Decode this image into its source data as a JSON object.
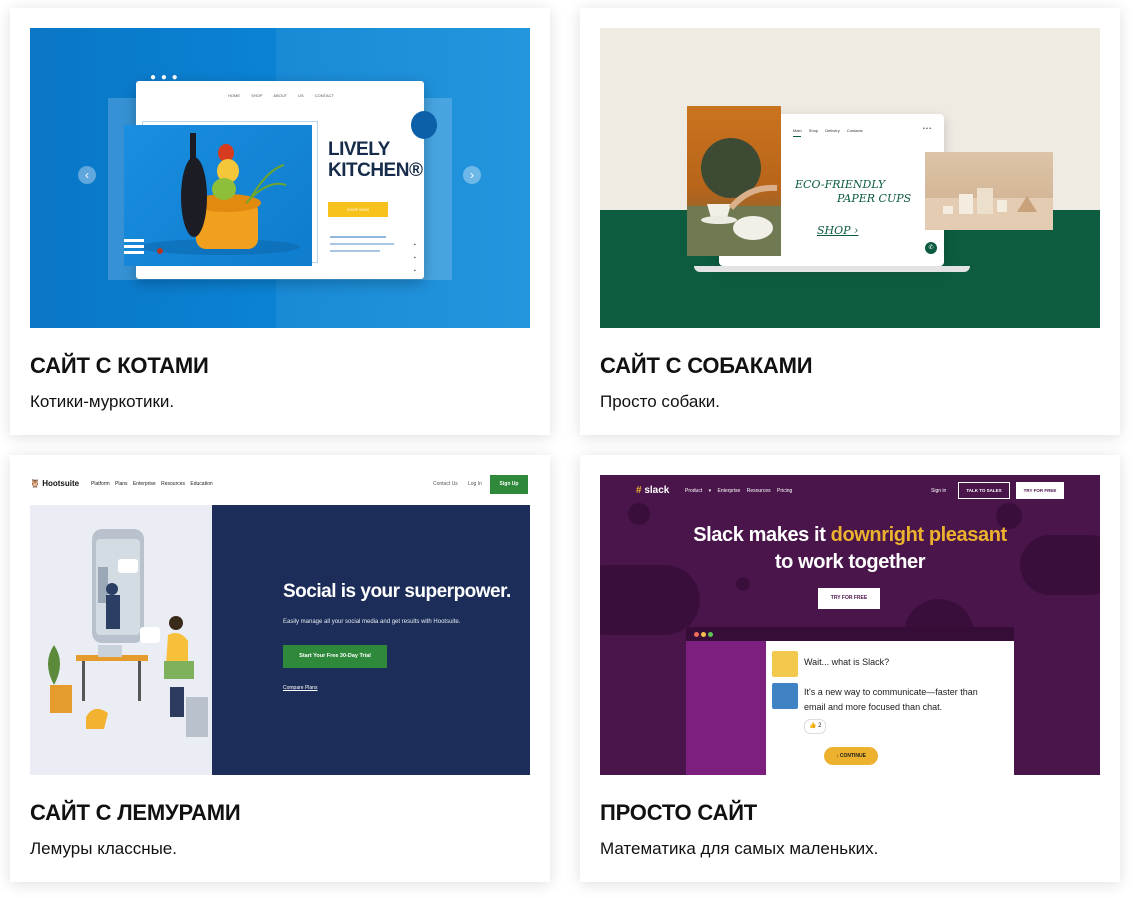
{
  "cards": [
    {
      "title": "САЙТ С КОТАМИ",
      "description": "Котики-муркотики.",
      "preview": {
        "nav": [
          "HOME",
          "SHOP",
          "ABOUT US",
          "CONTACT"
        ],
        "heading_line1": "LIVELY",
        "heading_line2": "KITCHEN®",
        "button": "SHOP NOW"
      }
    },
    {
      "title": "САЙТ С СОБАКАМИ",
      "description": "Просто собаки.",
      "preview": {
        "nav": [
          "Main",
          "Shop",
          "Delivery",
          "Contacts"
        ],
        "heading_line1": "ECO-FRIENDLY",
        "heading_line2": "PAPER CUPS",
        "shop_link": "SHOP ›"
      }
    },
    {
      "title": "САЙТ С ЛЕМУРАМИ",
      "description": "Лемуры классные.",
      "preview": {
        "logo": "Hootsuite",
        "nav": [
          "Platform",
          "Plans",
          "Enterprise",
          "Resources",
          "Education"
        ],
        "contact": "Contact Us",
        "login": "Log In",
        "signup": "Sign Up",
        "headline": "Social is your superpower.",
        "subtext": "Easily manage all your social media and get results with Hootsuite.",
        "cta": "Start Your Free 30-Day Trial",
        "compare": "Compare Plans"
      }
    },
    {
      "title": "ПРОСТО САЙТ",
      "description": "Математика для самых маленьких.",
      "preview": {
        "logo": "slack",
        "nav": [
          "Product ▾",
          "Enterprise",
          "Resources",
          "Pricing"
        ],
        "signin": "Sign in",
        "talk": "TALK TO SALES",
        "try_top": "TRY FOR FREE",
        "headline_a": "Slack makes it ",
        "headline_b": "downright pleasant",
        "headline_c": "to work together",
        "try_button": "TRY FOR FREE",
        "msg1": "Wait... what is Slack?",
        "msg2_line1": "It's a new way to communicate—faster than",
        "msg2_line2": "email and more focused than chat.",
        "reaction": "👍 2",
        "continue": "CONTINUE"
      }
    }
  ],
  "colors": {
    "cats_bg": "#0a7fd0",
    "dogs_green": "#0d5c40",
    "lemur_navy": "#1b2d58",
    "slack_purple": "#4a154b",
    "slack_yellow": "#ecb22e"
  }
}
